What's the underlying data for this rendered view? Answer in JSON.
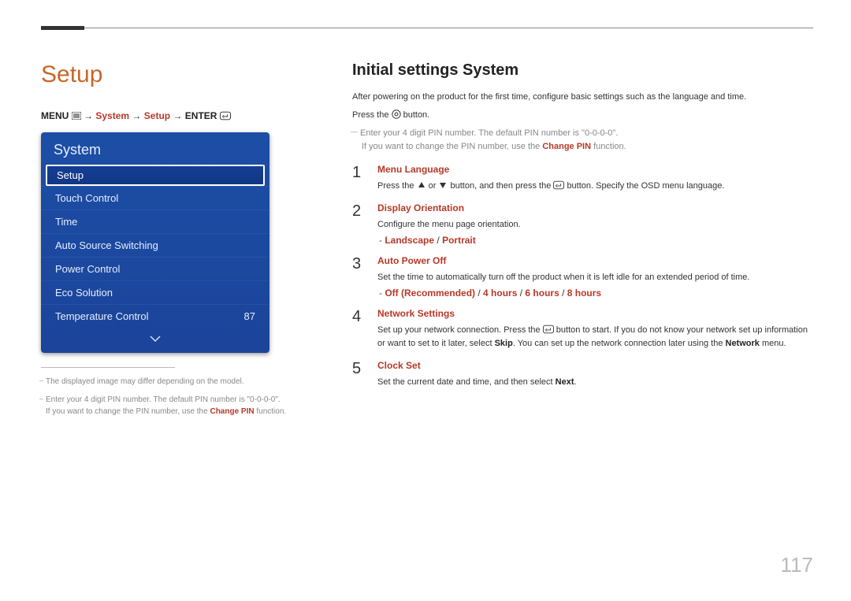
{
  "page_title": "Setup",
  "breadcrumb": {
    "prefix": "MENU",
    "arrow": " → ",
    "system": "System",
    "setup": "Setup",
    "enter": "ENTER"
  },
  "menu_panel": {
    "header": "System",
    "items": [
      {
        "label": "Setup",
        "value": "",
        "selected": true
      },
      {
        "label": "Touch Control",
        "value": ""
      },
      {
        "label": "Time",
        "value": ""
      },
      {
        "label": "Auto Source Switching",
        "value": ""
      },
      {
        "label": "Power Control",
        "value": ""
      },
      {
        "label": "Eco Solution",
        "value": ""
      },
      {
        "label": "Temperature Control",
        "value": "87"
      }
    ]
  },
  "left_footnotes": {
    "note1": "The displayed image may differ depending on the model.",
    "note2a": "Enter your 4 digit PIN number. The default PIN number is \"0-0-0-0\".",
    "note2b_pre": "If you want to change the PIN number, use the ",
    "note2b_em": "Change PIN",
    "note2b_post": " function."
  },
  "right": {
    "heading": "Initial settings System",
    "intro1": "After powering on the product for the first time, configure basic settings such as the language and time.",
    "intro2_pre": "Press the ",
    "intro2_post": " button.",
    "pin_note_a": "Enter your 4 digit PIN number. The default PIN number is \"0-0-0-0\".",
    "pin_note_b_pre": "If you want to change the PIN number, use the ",
    "pin_note_b_em": "Change PIN",
    "pin_note_b_post": " function."
  },
  "steps": [
    {
      "num": "1",
      "title": "Menu Language",
      "text_pre": "Press the ",
      "text_mid": " or ",
      "text_mid2": " button, and then press the ",
      "text_post": " button. Specify the OSD menu language."
    },
    {
      "num": "2",
      "title": "Display Orientation",
      "text": "Configure the menu page orientation.",
      "options": [
        "Landscape",
        "Portrait"
      ]
    },
    {
      "num": "3",
      "title": "Auto Power Off",
      "text": "Set the time to automatically turn off the product when it is left idle for an extended period of time.",
      "options": [
        "Off (Recommended)",
        "4 hours",
        "6 hours",
        "8 hours"
      ]
    },
    {
      "num": "4",
      "title": "Network Settings",
      "text_pre": "Set up your network connection. Press the ",
      "text_mid": " button to start. If you do not know your network set up information or want to set to it later, select ",
      "skip": "Skip",
      "text_mid2": ". You can set up the network connection later using the ",
      "network": "Network",
      "text_post": " menu."
    },
    {
      "num": "5",
      "title": "Clock Set",
      "text_pre": "Set the current date and time, and then select ",
      "next": "Next",
      "text_post": "."
    }
  ],
  "page_number": "117"
}
